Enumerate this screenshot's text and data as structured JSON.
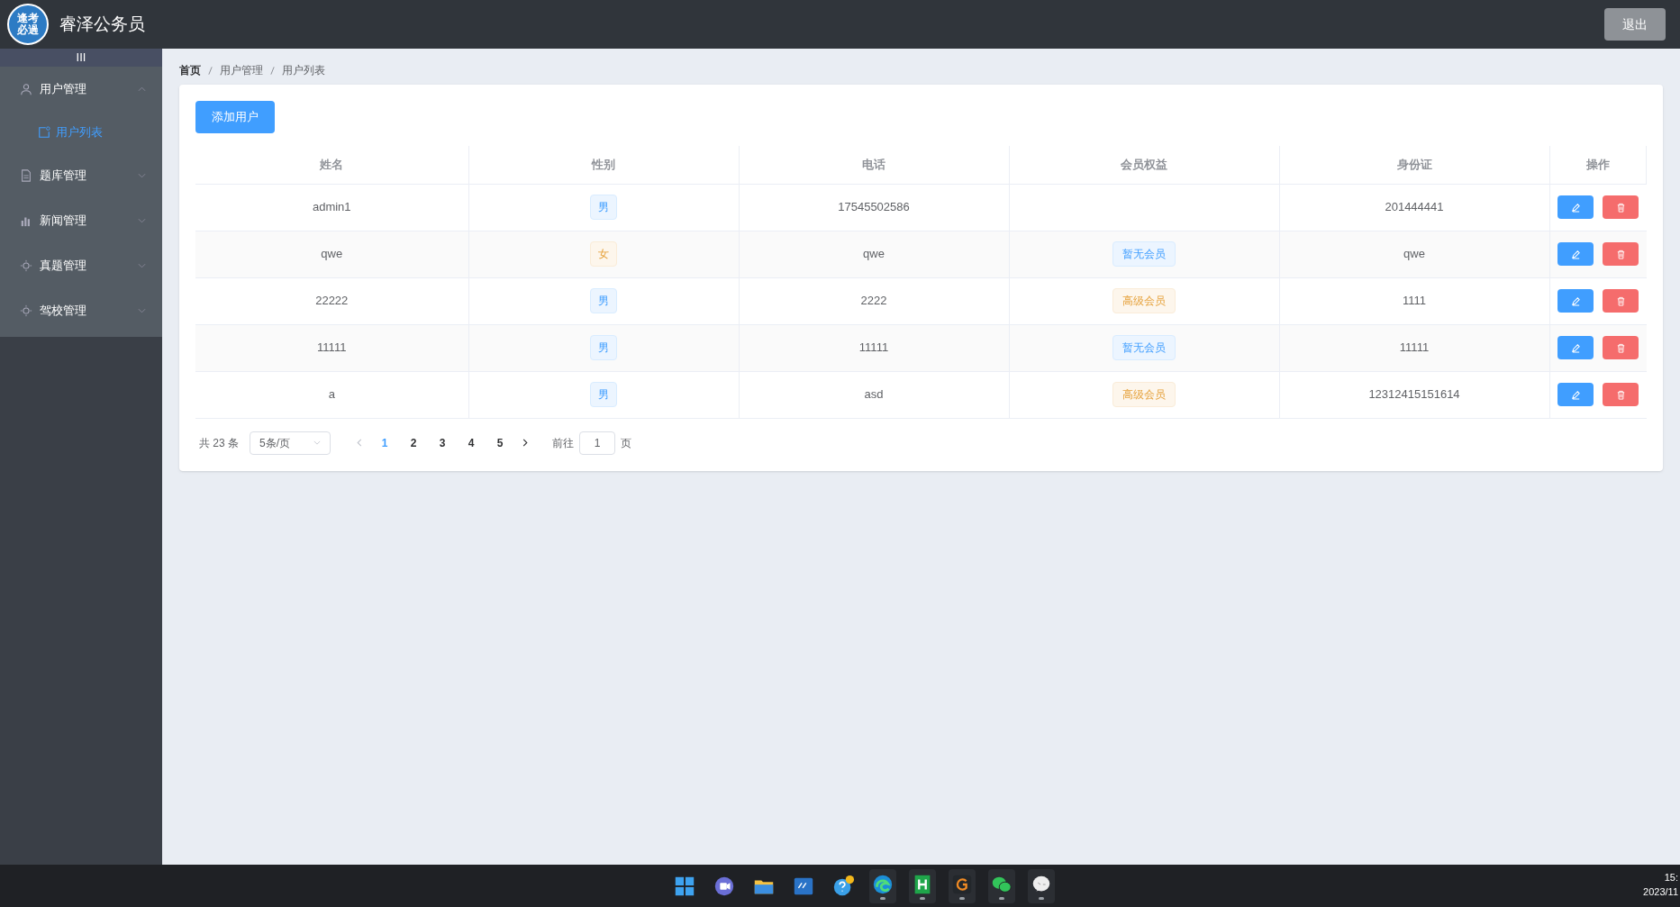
{
  "header": {
    "logo_text": "逢考必過",
    "title": "睿泽公务员",
    "logout": "退出"
  },
  "sidebar": {
    "toggle": "III",
    "items": [
      {
        "label": "用户管理",
        "kind": "user",
        "expanded": true,
        "children": [
          {
            "label": "用户列表",
            "selected": true
          }
        ]
      },
      {
        "label": "题库管理",
        "kind": "doc",
        "expanded": false
      },
      {
        "label": "新闻管理",
        "kind": "chart",
        "expanded": false
      },
      {
        "label": "真题管理",
        "kind": "sun",
        "expanded": false
      },
      {
        "label": "驾校管理",
        "kind": "sun",
        "expanded": false
      }
    ]
  },
  "breadcrumb": [
    "首页",
    "用户管理",
    "用户列表"
  ],
  "add_button": "添加用户",
  "table": {
    "columns": [
      "姓名",
      "性别",
      "电话",
      "会员权益",
      "身份证",
      "操作"
    ],
    "rows": [
      {
        "name": "admin1",
        "gender": {
          "text": "男",
          "kind": "male"
        },
        "phone": "17545502586",
        "id_card": "201444441"
      },
      {
        "name": "qwe",
        "gender": {
          "text": "女",
          "kind": "female"
        },
        "phone": "qwe",
        "membership": {
          "text": "暂无会员",
          "kind": "none"
        },
        "id_card": "qwe"
      },
      {
        "name": "22222",
        "gender": {
          "text": "男",
          "kind": "male"
        },
        "phone": "2222",
        "membership": {
          "text": "高级会员",
          "kind": "premium"
        },
        "id_card": "1111"
      },
      {
        "name": "11111",
        "gender": {
          "text": "男",
          "kind": "male"
        },
        "phone": "11111",
        "membership": {
          "text": "暂无会员",
          "kind": "none"
        },
        "id_card": "11111"
      },
      {
        "name": "a",
        "gender": {
          "text": "男",
          "kind": "male"
        },
        "phone": "asd",
        "membership": {
          "text": "高级会员",
          "kind": "premium"
        },
        "id_card": "12312415151614"
      }
    ]
  },
  "pagination": {
    "total": "共 23 条",
    "page_size": "5条/页",
    "pages": [
      {
        "label": "1",
        "selected": true
      },
      {
        "label": "2",
        "selected": false
      },
      {
        "label": "3",
        "selected": false
      },
      {
        "label": "4",
        "selected": false
      },
      {
        "label": "5",
        "selected": false
      }
    ],
    "goto_label": "前往",
    "goto_value": "1",
    "goto_suffix": "页"
  },
  "taskbar": {
    "apps": [
      {
        "kind": "start",
        "active": false
      },
      {
        "kind": "chat",
        "active": false
      },
      {
        "kind": "folder",
        "active": false
      },
      {
        "kind": "hp",
        "active": false
      },
      {
        "kind": "help",
        "active": false
      },
      {
        "kind": "browser",
        "active": true
      },
      {
        "kind": "h",
        "active": true
      },
      {
        "kind": "g",
        "active": true
      },
      {
        "kind": "wechat",
        "active": true
      },
      {
        "kind": "bubble",
        "active": true
      }
    ],
    "clock_time": "15:",
    "clock_date": "2023/11"
  }
}
